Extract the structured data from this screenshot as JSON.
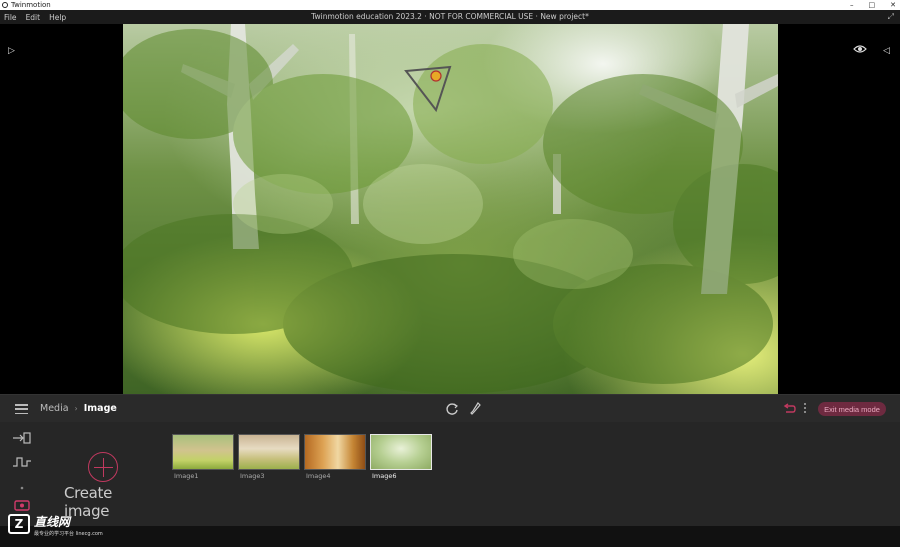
{
  "window": {
    "app_title": "Twinmotion",
    "controls": [
      "–",
      "□",
      "✕"
    ]
  },
  "menu": {
    "items": [
      "File",
      "Edit",
      "Help"
    ],
    "center_title": "Twinmotion education 2023.2 · NOT FOR COMMERCIAL USE · New project*"
  },
  "toolbar": {
    "breadcrumb_media": "Media",
    "breadcrumb_sep": "›",
    "breadcrumb_image": "Image",
    "mode_button_label": "Exit media mode",
    "undo_color": "#c0395f"
  },
  "panel": {
    "create_label": "Create image",
    "thumbnails": [
      {
        "label": "Image1",
        "selected": false
      },
      {
        "label": "Image3",
        "selected": false
      },
      {
        "label": "Image4",
        "selected": false
      },
      {
        "label": "Image6",
        "selected": true
      }
    ]
  },
  "watermark": {
    "logo": "Z",
    "name": "直线网",
    "sub": "最专业的学习平台 linecg.com"
  },
  "colors": {
    "accent": "#c0395f",
    "toolbar_bg": "#2a2a2a",
    "panel_bg": "#262626"
  }
}
